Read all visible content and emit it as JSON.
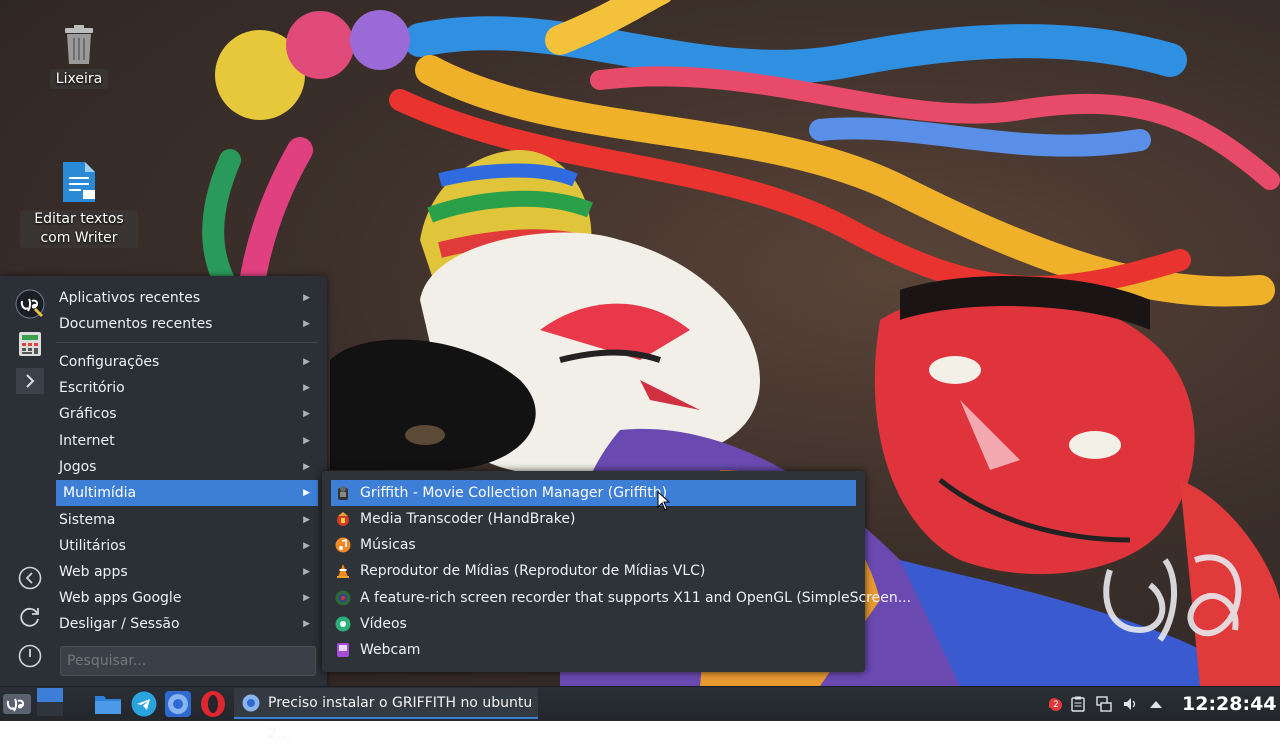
{
  "desktop": {
    "icons": [
      {
        "label": "Lixeira",
        "icon": "trash-icon"
      },
      {
        "label": "Editar textos com Writer",
        "icon": "writer-document-icon"
      }
    ]
  },
  "menu": {
    "strip": [
      "big-logo-icon",
      "calculator-icon",
      "expand-arrow-icon",
      "back-icon",
      "refresh-icon",
      "power-icon"
    ],
    "top_items": [
      {
        "label": "Aplicativos recentes"
      },
      {
        "label": "Documentos recentes"
      }
    ],
    "categories": [
      {
        "label": "Configurações"
      },
      {
        "label": "Escritório"
      },
      {
        "label": "Gráficos"
      },
      {
        "label": "Internet"
      },
      {
        "label": "Jogos"
      },
      {
        "label": "Multimídia",
        "active": true
      },
      {
        "label": "Sistema"
      },
      {
        "label": "Utilitários"
      },
      {
        "label": "Web apps"
      },
      {
        "label": "Web apps Google"
      },
      {
        "label": "Desligar / Sessão"
      }
    ],
    "search_placeholder": "Pesquisar..."
  },
  "submenu": {
    "items": [
      {
        "label": "Griffith - Movie Collection Manager (Griffith)",
        "icon": "griffith-icon",
        "active": true
      },
      {
        "label": "Media Transcoder (HandBrake)",
        "icon": "handbrake-icon"
      },
      {
        "label": "Músicas",
        "icon": "music-icon"
      },
      {
        "label": "Reprodutor de Mídias (Reprodutor de Mídias VLC)",
        "icon": "vlc-cone-icon"
      },
      {
        "label": "A feature-rich screen recorder that supports X11 and OpenGL (SimpleScreen...",
        "icon": "screen-recorder-icon"
      },
      {
        "label": "Vídeos",
        "icon": "videos-icon"
      },
      {
        "label": "Webcam",
        "icon": "webcam-icon"
      }
    ]
  },
  "taskbar": {
    "launchers": [
      "big-logo-icon",
      "workspace-switcher-icon",
      "file-manager-icon",
      "telegram-icon",
      "chromium-icon",
      "opera-icon"
    ],
    "active_window": "Preciso instalar o GRIFFITH no ubuntu 2...",
    "tray_badge": "2",
    "tray": [
      "notification-icon",
      "clipboard-icon",
      "network-icon",
      "volume-icon",
      "tray-expand-icon"
    ],
    "clock": "12:28:44"
  },
  "colors": {
    "accent": "#3d7ed6",
    "menu_bg": "#2b3036",
    "taskbar_bg": "#23272c"
  }
}
